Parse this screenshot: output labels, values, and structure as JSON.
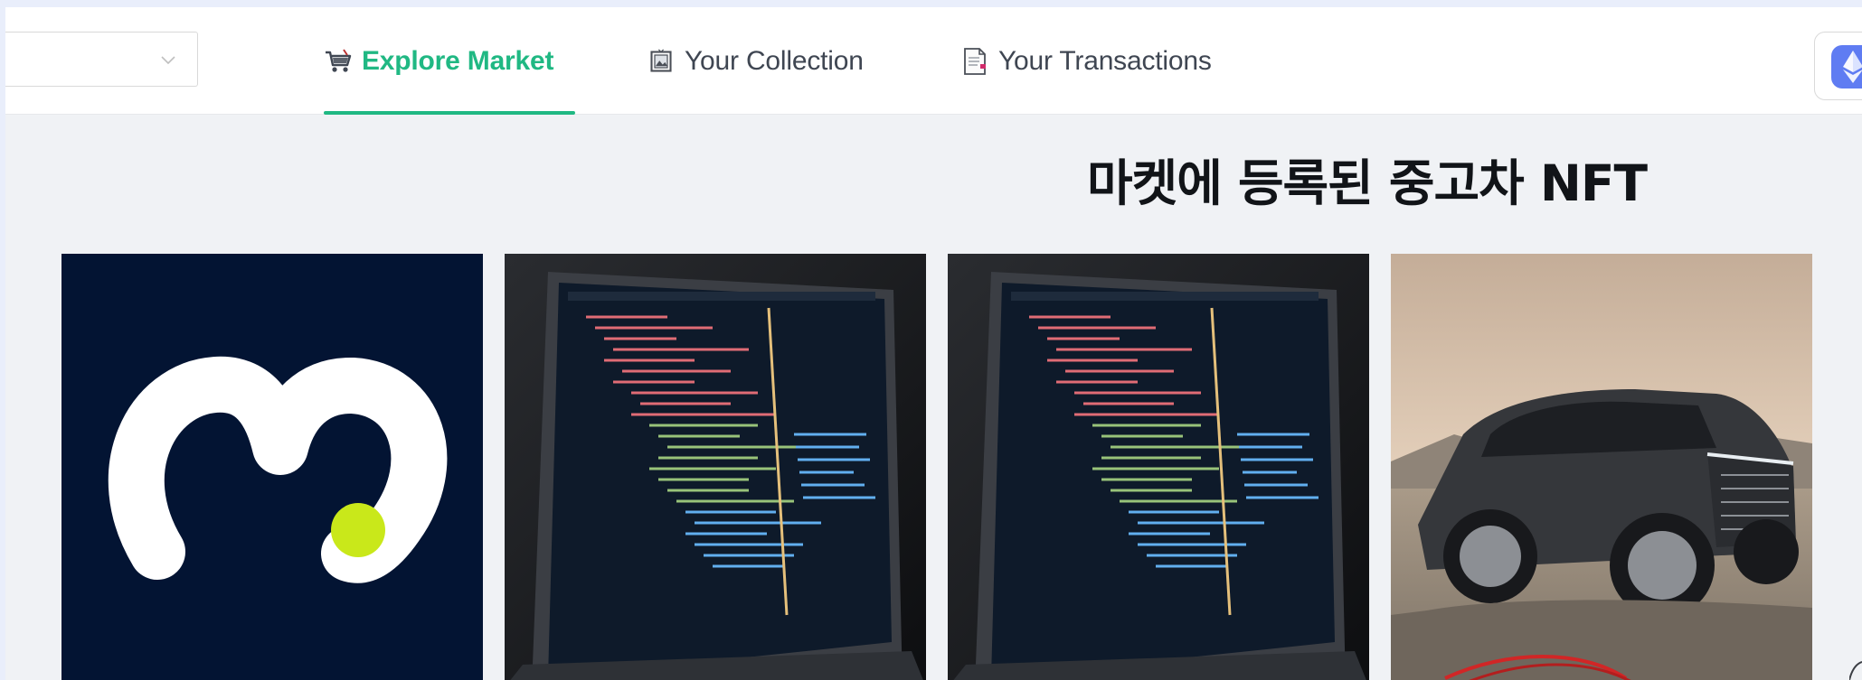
{
  "nav": {
    "select": {
      "value": "",
      "chevron_icon": "chevron-down-icon"
    },
    "tabs": [
      {
        "label": "Explore Market",
        "icon": "shopping-cart-icon",
        "active": true
      },
      {
        "label": "Your Collection",
        "icon": "framed-picture-icon",
        "active": false
      },
      {
        "label": "Your Transactions",
        "icon": "document-icon",
        "active": false
      }
    ],
    "wallet": {
      "icon": "ethereum-icon"
    }
  },
  "main": {
    "heading": "마켓에 등록된 중고차 NFT",
    "cards": [
      {
        "image": "brand-logo-m"
      },
      {
        "image": "laptop-code-editor"
      },
      {
        "image": "laptop-code-editor"
      },
      {
        "image": "black-suv"
      }
    ]
  },
  "colors": {
    "accent": "#20b883",
    "text_default": "#3f4652",
    "background": "#f0f2f5",
    "logo_green": "#c9e81a",
    "logo_navy": "#031433",
    "eth_blue": "#5f7cf2"
  }
}
